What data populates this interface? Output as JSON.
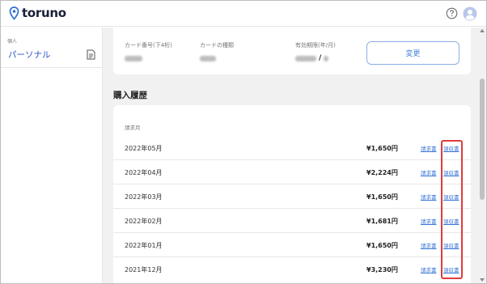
{
  "app": {
    "logo_text": "toruno",
    "logo_icon": "location-pin-icon",
    "help_icon": "question-circle-icon",
    "avatar_icon": "user-avatar-icon",
    "accent_color": "#3b78d8"
  },
  "sidebar": {
    "group_label": "個人",
    "items": [
      {
        "label": "パーソナル",
        "icon": "document-icon",
        "color": "#2c57c9"
      }
    ]
  },
  "card_info": {
    "fields": [
      {
        "label": "カード番号(下4桁)"
      },
      {
        "label": "カードの種類"
      },
      {
        "label": "有効期限(年/月)",
        "visible_separator": "/"
      }
    ],
    "change_button": "変更"
  },
  "purchase_history": {
    "title": "購入履歴",
    "column_header": "請求月",
    "rows": [
      {
        "month": "2022年05月",
        "amount": "¥1,650円",
        "invoice": "請求書",
        "receipt": "領収書"
      },
      {
        "month": "2022年04月",
        "amount": "¥2,224円",
        "invoice": "請求書",
        "receipt": "領収書"
      },
      {
        "month": "2022年03月",
        "amount": "¥1,650円",
        "invoice": "請求書",
        "receipt": "領収書"
      },
      {
        "month": "2022年02月",
        "amount": "¥1,681円",
        "invoice": "請求書",
        "receipt": "領収書"
      },
      {
        "month": "2022年01月",
        "amount": "¥1,650円",
        "invoice": "請求書",
        "receipt": "領収書"
      },
      {
        "month": "2021年12月",
        "amount": "¥3,230円",
        "invoice": "請求書",
        "receipt": "領収書"
      }
    ]
  },
  "annotation": {
    "highlight_color": "#e03b3b"
  }
}
